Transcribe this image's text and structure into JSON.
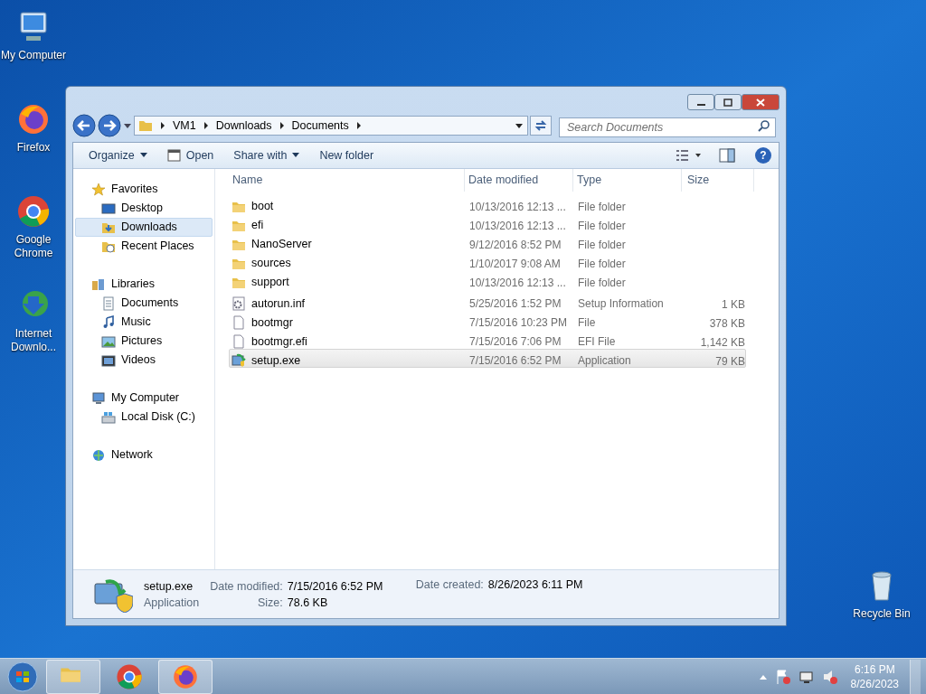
{
  "desktop_icons": [
    {
      "label": "My Computer",
      "kind": "computer"
    },
    {
      "label": "Firefox",
      "kind": "firefox"
    },
    {
      "label": "Google Chrome",
      "kind": "chrome"
    },
    {
      "label": "Internet Downlo...",
      "kind": "idm"
    },
    {
      "label": "Recycle Bin",
      "kind": "bin"
    }
  ],
  "window": {
    "breadcrumb": [
      "VM1",
      "Downloads",
      "Documents"
    ],
    "search": {
      "placeholder": "Search Documents"
    },
    "toolbar": [
      {
        "label": "Organize",
        "kind": "menu"
      },
      {
        "label": "Open",
        "kind": "open"
      },
      {
        "label": "Share with",
        "kind": "menu"
      },
      {
        "label": "New folder",
        "kind": "plain"
      }
    ],
    "sidebar": [
      {
        "label": "Favorites",
        "kind": "star",
        "selected": false,
        "children": [
          {
            "label": "Desktop",
            "kind": "desktop",
            "selected": false
          },
          {
            "label": "Downloads",
            "kind": "downloads",
            "selected": true
          },
          {
            "label": "Recent Places",
            "kind": "recent",
            "selected": false
          }
        ]
      },
      {
        "label": "Libraries",
        "kind": "library",
        "selected": false,
        "children": [
          {
            "label": "Documents",
            "kind": "documents",
            "selected": false
          },
          {
            "label": "Music",
            "kind": "music",
            "selected": false
          },
          {
            "label": "Pictures",
            "kind": "pictures",
            "selected": false
          },
          {
            "label": "Videos",
            "kind": "videos",
            "selected": false
          }
        ]
      },
      {
        "label": "My Computer",
        "kind": "computer",
        "selected": false,
        "children": [
          {
            "label": "Local Disk (C:)",
            "kind": "disk",
            "selected": false
          }
        ]
      },
      {
        "label": "Network",
        "kind": "network",
        "selected": false
      }
    ],
    "help": "?",
    "columns": [
      "Name",
      "Date modified",
      "Type",
      "Size"
    ],
    "files": [
      {
        "name": "boot",
        "date": "10/13/2016 12:13 ...",
        "type": "File folder",
        "kind": "folder",
        "selected": false
      },
      {
        "name": "efi",
        "date": "10/13/2016 12:13 ...",
        "type": "File folder",
        "kind": "folder",
        "selected": false
      },
      {
        "name": "NanoServer",
        "date": "9/12/2016 8:52 PM",
        "type": "File folder",
        "kind": "folder",
        "selected": false
      },
      {
        "name": "sources",
        "date": "1/10/2017 9:08 AM",
        "type": "File folder",
        "kind": "folder",
        "selected": false
      },
      {
        "name": "support",
        "date": "10/13/2016 12:13 ...",
        "type": "File folder",
        "kind": "folder",
        "selected": false
      },
      {
        "name": "autorun.inf",
        "date": "5/25/2016 1:52 PM",
        "type": "Setup Information",
        "size": "1 KB",
        "kind": "settings",
        "selected": false
      },
      {
        "name": "bootmgr",
        "date": "7/15/2016 10:23 PM",
        "type": "File",
        "size": "378 KB",
        "kind": "file",
        "selected": false
      },
      {
        "name": "bootmgr.efi",
        "date": "7/15/2016 7:06 PM",
        "type": "EFI File",
        "size": "1,142 KB",
        "kind": "file",
        "selected": false
      },
      {
        "name": "setup.exe",
        "date": "7/15/2016 6:52 PM",
        "type": "Application",
        "size": "79 KB",
        "kind": "app",
        "selected": true
      }
    ],
    "details": {
      "name": "setup.exe",
      "type": "Application",
      "fields": [
        {
          "label": "Date modified:",
          "value": "7/15/2016 6:52 PM"
        },
        {
          "label": "Size:",
          "value": "78.6 KB"
        },
        {
          "label": "Date created:",
          "value": "8/26/2023 6:11 PM"
        }
      ]
    }
  },
  "taskbar": {
    "apps": [
      {
        "kind": "explorer",
        "active": true
      },
      {
        "kind": "chrome",
        "active": false
      },
      {
        "kind": "firefox",
        "active": true
      }
    ],
    "time": "6:16 PM",
    "date": "8/26/2023"
  }
}
